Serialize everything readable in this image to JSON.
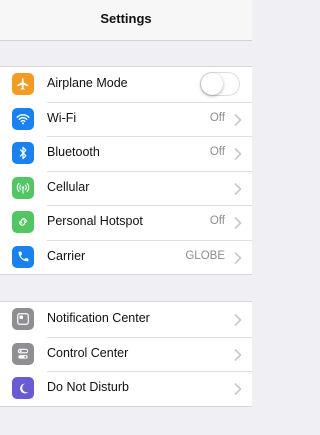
{
  "nav": {
    "title": "Settings"
  },
  "group1": [
    {
      "name": "airplane-mode",
      "label": "Airplane Mode",
      "icon": "airplane-icon",
      "color": "#f39c23",
      "control": "toggle",
      "on": false
    },
    {
      "name": "wifi",
      "label": "Wi-Fi",
      "icon": "wifi-icon",
      "color": "#1a82f0",
      "value": "Off"
    },
    {
      "name": "bluetooth",
      "label": "Bluetooth",
      "icon": "bluetooth-icon",
      "color": "#1a82f0",
      "value": "Off"
    },
    {
      "name": "cellular",
      "label": "Cellular",
      "icon": "cellular-icon",
      "color": "#52c662",
      "value": ""
    },
    {
      "name": "personal-hotspot",
      "label": "Personal Hotspot",
      "icon": "hotspot-icon",
      "color": "#52c662",
      "value": "Off"
    },
    {
      "name": "carrier",
      "label": "Carrier",
      "icon": "phone-icon",
      "color": "#1a82f0",
      "value": "GLOBE"
    }
  ],
  "group2": [
    {
      "name": "notification-center",
      "label": "Notification Center",
      "icon": "notification-center-icon",
      "color": "#8e8e93",
      "value": ""
    },
    {
      "name": "control-center",
      "label": "Control Center",
      "icon": "control-center-icon",
      "color": "#8e8e93",
      "value": ""
    },
    {
      "name": "do-not-disturb",
      "label": "Do Not Disturb",
      "icon": "moon-icon",
      "color": "#6a5bd3",
      "value": ""
    }
  ]
}
